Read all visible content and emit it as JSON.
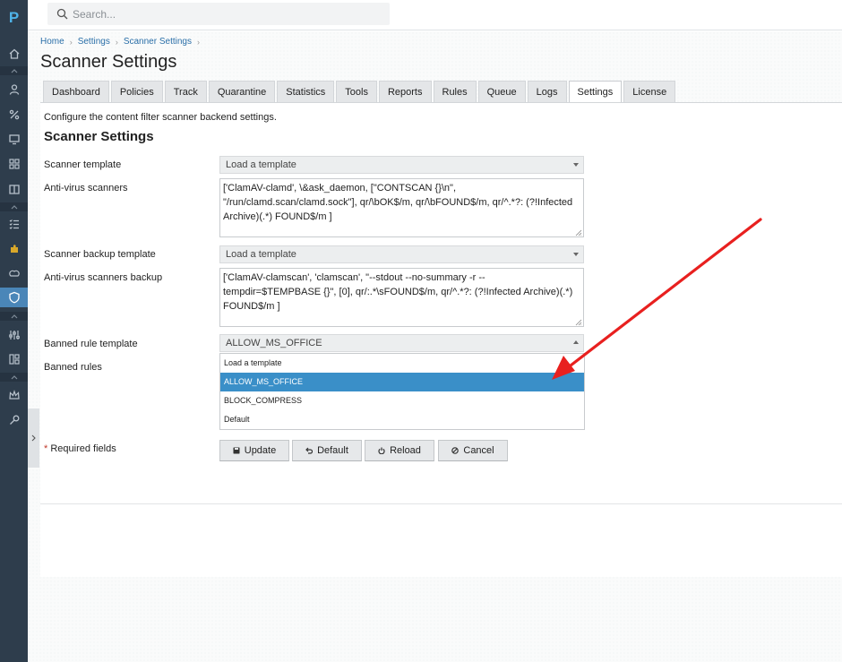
{
  "search": {
    "placeholder": "Search..."
  },
  "logo": "P",
  "breadcrumb": [
    "Home",
    "Settings",
    "Scanner Settings"
  ],
  "page_title": "Scanner Settings",
  "tabs": [
    "Dashboard",
    "Policies",
    "Track",
    "Quarantine",
    "Statistics",
    "Tools",
    "Reports",
    "Rules",
    "Queue",
    "Logs",
    "Settings",
    "License"
  ],
  "active_tab": "Settings",
  "description": "Configure the content filter scanner backend settings.",
  "section_title": "Scanner Settings",
  "fields": {
    "scanner_template": {
      "label": "Scanner template",
      "value": "Load a template"
    },
    "antivirus": {
      "label": "Anti-virus scanners",
      "value": "['ClamAV-clamd', \\&ask_daemon, [\"CONTSCAN {}\\n\", \"/run/clamd.scan/clamd.sock\"], qr/\\bOK$/m, qr/\\bFOUND$/m, qr/^.*?: (?!Infected Archive)(.*) FOUND$/m ]"
    },
    "backup_template": {
      "label": "Scanner backup template",
      "value": "Load a template"
    },
    "antivirus_backup": {
      "label": "Anti-virus scanners backup",
      "value": "['ClamAV-clamscan', 'clamscan', \"--stdout --no-summary -r --tempdir=$TEMPBASE {}\", [0], qr/:.*\\sFOUND$/m, qr/^.*?: (?!Infected Archive)(.*) FOUND$/m ]"
    },
    "banned_template": {
      "label": "Banned rule template",
      "value": "ALLOW_MS_OFFICE"
    },
    "banned_rules": {
      "label": "Banned rules"
    }
  },
  "dropdown_options": [
    "Load a template",
    "ALLOW_MS_OFFICE",
    "BLOCK_COMPRESS",
    "Default"
  ],
  "dropdown_selected": "ALLOW_MS_OFFICE",
  "required": {
    "star": "*",
    "text": "Required fields"
  },
  "buttons": {
    "update": "Update",
    "default": "Default",
    "reload": "Reload",
    "cancel": "Cancel"
  },
  "colors": {
    "rail": "#2e3d4c",
    "accent": "#3a8fc8",
    "link": "#2a6fa8",
    "arrow": "#e8201f"
  },
  "rail_icons": [
    "home-icon",
    "user-icon",
    "percent-icon",
    "monitor-icon",
    "grid-icon",
    "book-icon",
    "checklist-icon",
    "puzzle-icon",
    "cloud-icon",
    "shield-icon",
    "sliders-icon",
    "layout-icon",
    "crown-icon",
    "wrench-icon"
  ]
}
